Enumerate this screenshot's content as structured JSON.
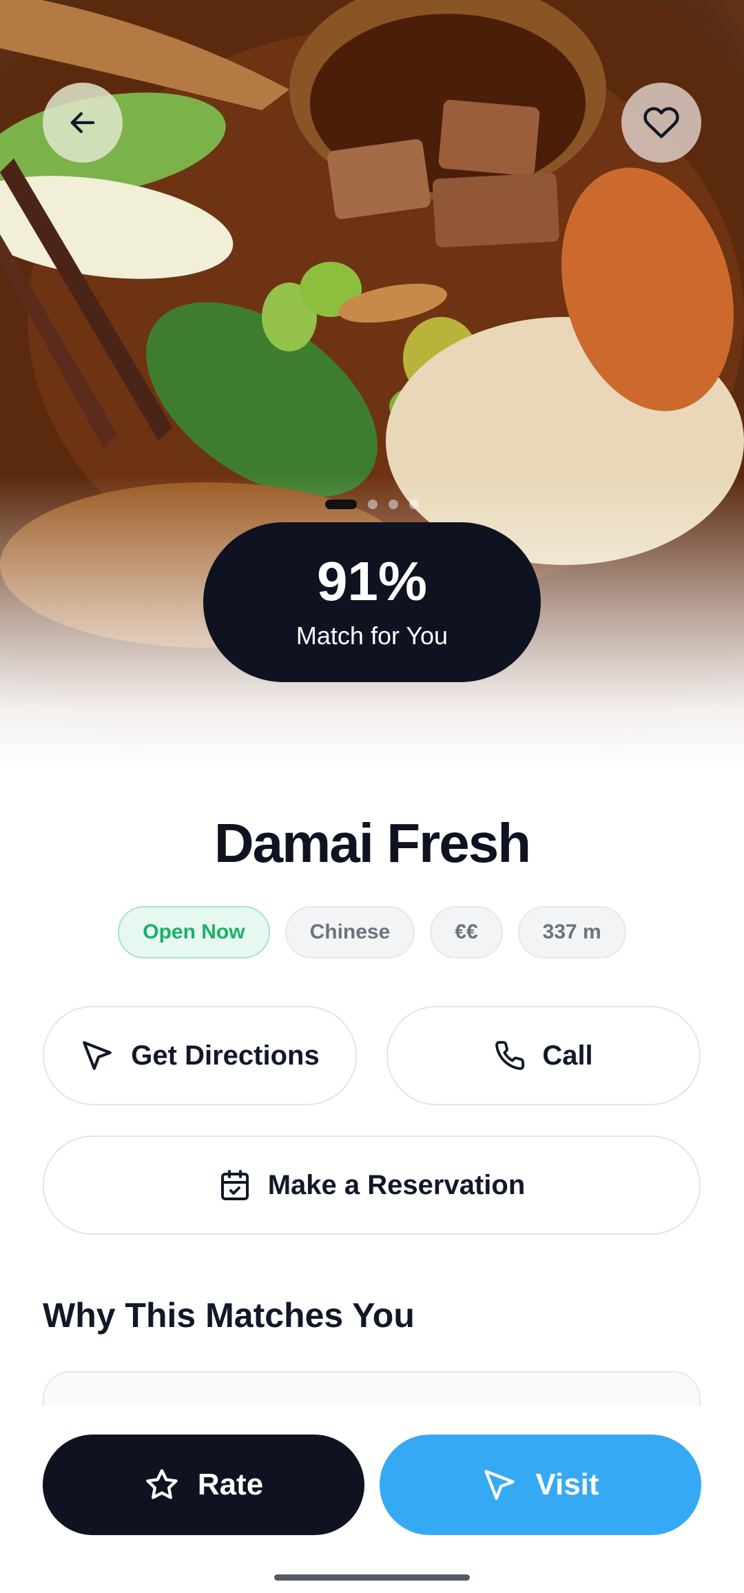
{
  "hero": {
    "match": {
      "percent": "91%",
      "label": "Match for You"
    },
    "carousel": {
      "count": 4,
      "active_index": 0
    },
    "icons": {
      "back": "arrow-left-icon",
      "favorite": "heart-icon"
    }
  },
  "restaurant": {
    "name": "Damai Fresh",
    "chips": {
      "status": "Open Now",
      "cuisine": "Chinese",
      "price": "€€",
      "distance": "337 m"
    }
  },
  "actions": {
    "directions": "Get Directions",
    "call": "Call",
    "reservation": "Make a Reservation"
  },
  "section": {
    "title": "Why This Matches You"
  },
  "bottom_bar": {
    "rate": "Rate",
    "visit": "Visit"
  },
  "colors": {
    "dark": "#0f1220",
    "accent_blue": "#36a9f5",
    "open_green": "#17b26a"
  }
}
